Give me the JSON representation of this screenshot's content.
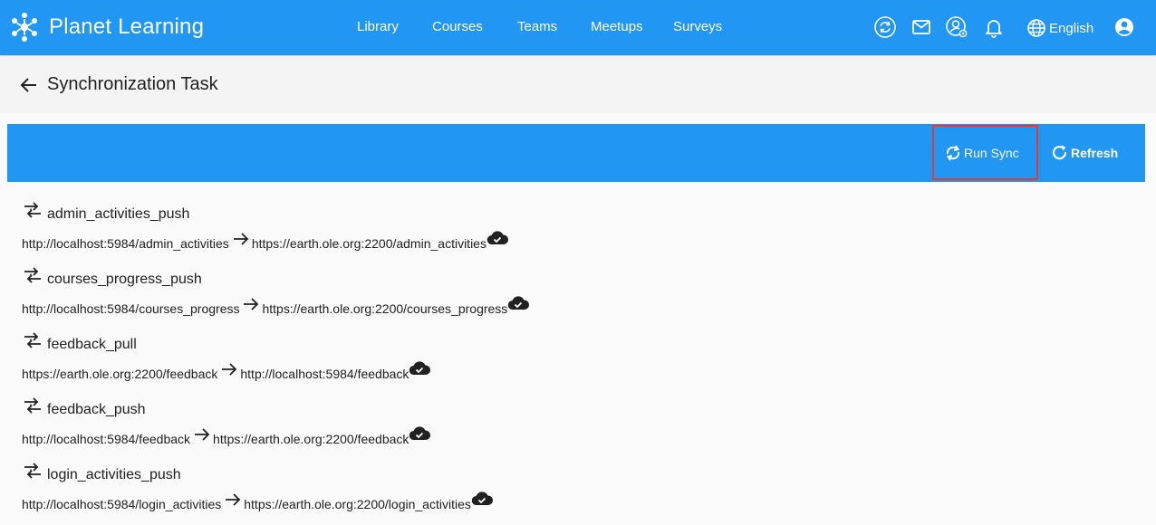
{
  "app": {
    "brand": "Planet Learning",
    "nav": [
      "Library",
      "Courses",
      "Teams",
      "Meetups",
      "Surveys"
    ],
    "language": "English",
    "icons": [
      "sync-status-icon",
      "mail-icon",
      "user-settings-icon",
      "bell-icon",
      "globe-icon",
      "account-icon"
    ]
  },
  "page": {
    "title": "Synchronization Task",
    "toolbar": {
      "run_sync": "Run Sync",
      "refresh": "Refresh"
    }
  },
  "tasks": [
    {
      "name": "admin_activities_push",
      "source": "http://localhost:5984/admin_activities",
      "target": "https://earth.ole.org:2200/admin_activities"
    },
    {
      "name": "courses_progress_push",
      "source": "http://localhost:5984/courses_progress",
      "target": "https://earth.ole.org:2200/courses_progress"
    },
    {
      "name": "feedback_pull",
      "source": "https://earth.ole.org:2200/feedback",
      "target": "http://localhost:5984/feedback"
    },
    {
      "name": "feedback_push",
      "source": "http://localhost:5984/feedback",
      "target": "https://earth.ole.org:2200/feedback"
    },
    {
      "name": "login_activities_push",
      "source": "http://localhost:5984/login_activities",
      "target": "https://earth.ole.org:2200/login_activities"
    }
  ],
  "colors": {
    "primary": "#2196f3",
    "highlight": "#e53935"
  }
}
